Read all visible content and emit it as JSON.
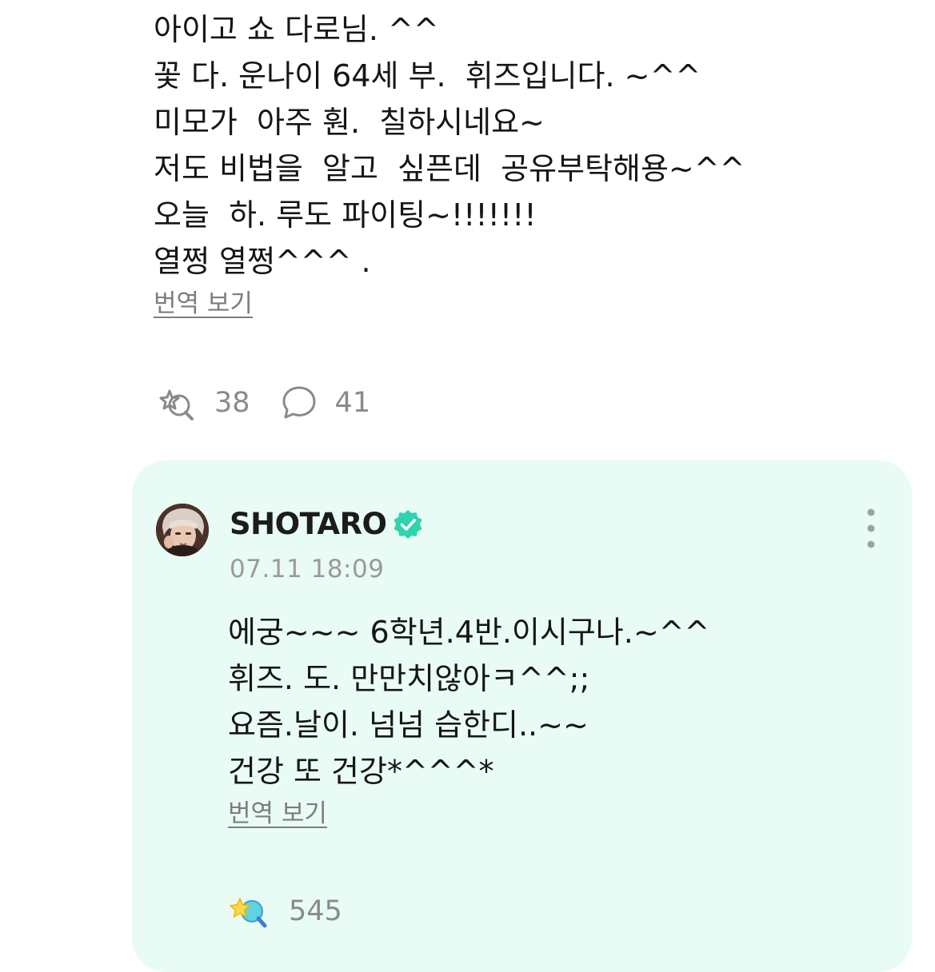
{
  "post": {
    "lines": [
      "아이고 쇼 다로님. ^^",
      "꽃 다. 운나이 64세 부.  휘즈입니다. ~^^",
      "미모가  아주 훤.  칠하시네요~",
      "저도 비법을  알고  싶픈데  공유부탁해용~^^",
      "오늘  하. 루도 파이팅~!!!!!!!",
      "열쩡 열쩡^^^ ."
    ],
    "translate_label": "번역 보기",
    "like_icon": "sparkle-like-icon",
    "like_count": "38",
    "comment_icon": "speech-bubble-icon",
    "comment_count": "41"
  },
  "reply": {
    "author": "SHOTARO",
    "verified_icon": "verified-badge-icon",
    "timestamp": "07.11 18:09",
    "lines": [
      "에궁~~~ 6학년.4반.이시구나.~^^",
      "휘즈. 도. 만만치않아ㅋ^^;;",
      "요즘.날이. 넘넘 습한디..~~",
      "건강 또 건강*^^^*"
    ],
    "translate_label": "번역 보기",
    "like_icon": "sparkle-like-filled-icon",
    "like_count": "545",
    "more_icon": "more-vertical-icon"
  },
  "colors": {
    "reply_background": "#e9fbf5",
    "verified": "#2fd3b0",
    "muted_text": "#8a8a8a"
  }
}
